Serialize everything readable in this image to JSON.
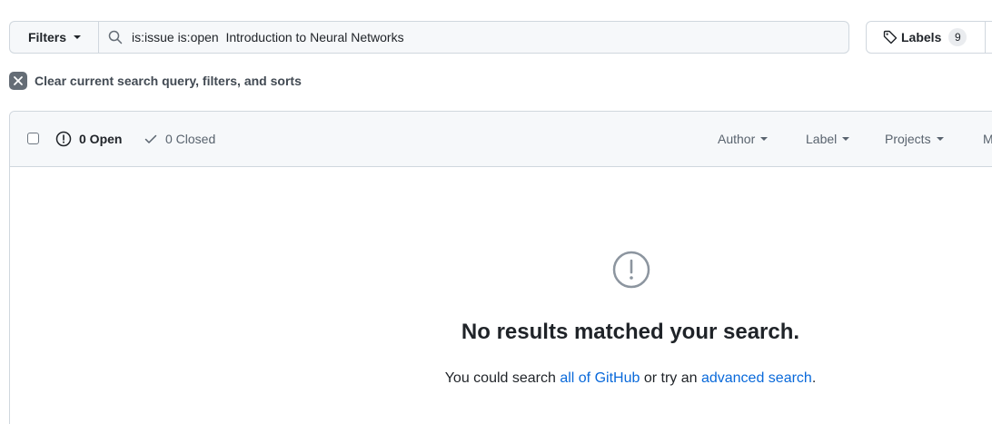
{
  "toolbar": {
    "filters_label": "Filters",
    "search_value": "is:issue is:open  Introduction to Neural Networks",
    "labels_label": "Labels",
    "labels_count": "9"
  },
  "clear": {
    "label": "Clear current search query, filters, and sorts"
  },
  "issues_header": {
    "open_label": "0 Open",
    "closed_label": "0 Closed",
    "filters": [
      "Author",
      "Label",
      "Projects",
      "M"
    ]
  },
  "blankslate": {
    "title": "No results matched your search.",
    "text_before": "You could search ",
    "link_all": "all of GitHub",
    "text_middle": " or try an ",
    "link_advanced": "advanced search",
    "text_after": "."
  },
  "icons": {
    "search": "search-icon",
    "tag": "tag-icon",
    "clear": "x-icon",
    "open": "issue-opened-icon",
    "closed": "check-icon",
    "blank": "alert-circle-icon"
  },
  "colors": {
    "link": "#0969da",
    "border": "#d0d7de",
    "header_bg": "#f6f8fa"
  }
}
